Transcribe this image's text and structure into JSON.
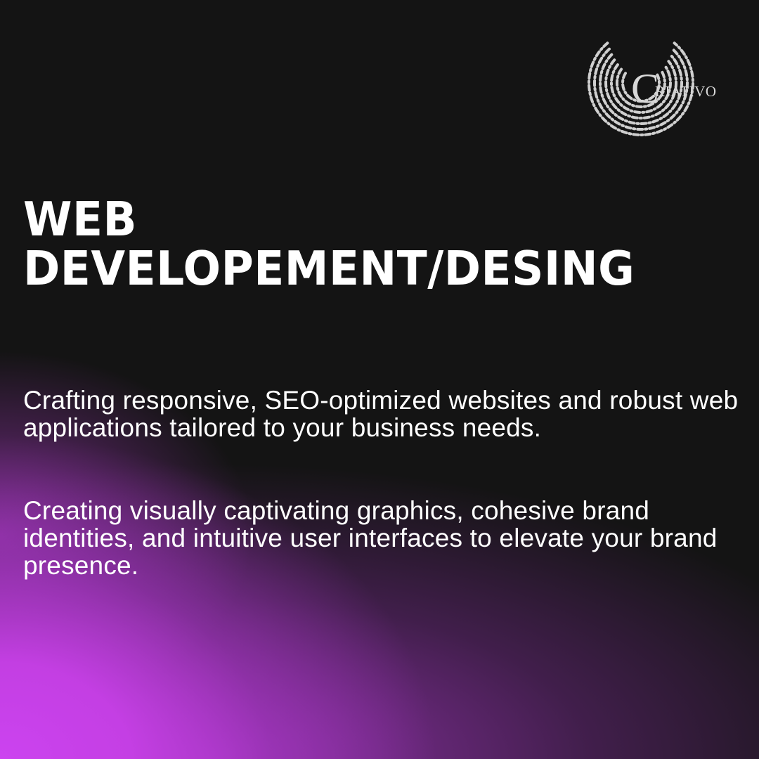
{
  "brand": {
    "logo_text": "RIATIVO",
    "logo_mark": "C",
    "logo_icon": "dotted-c-logo-icon"
  },
  "headline": {
    "line1": "WEB",
    "line2": "DEVELOPEMENT/DESING"
  },
  "paragraphs": {
    "first": "Crafting responsive, SEO-optimized websites and robust web applications tailored to your business needs.",
    "second": "Creating visually captivating graphics, cohesive brand identities, and intuitive user interfaces to elevate your brand presence."
  },
  "colors": {
    "background": "#141414",
    "accent_glow": "#cc43f0",
    "text": "#ffffff",
    "logo": "#cfcfcf"
  }
}
